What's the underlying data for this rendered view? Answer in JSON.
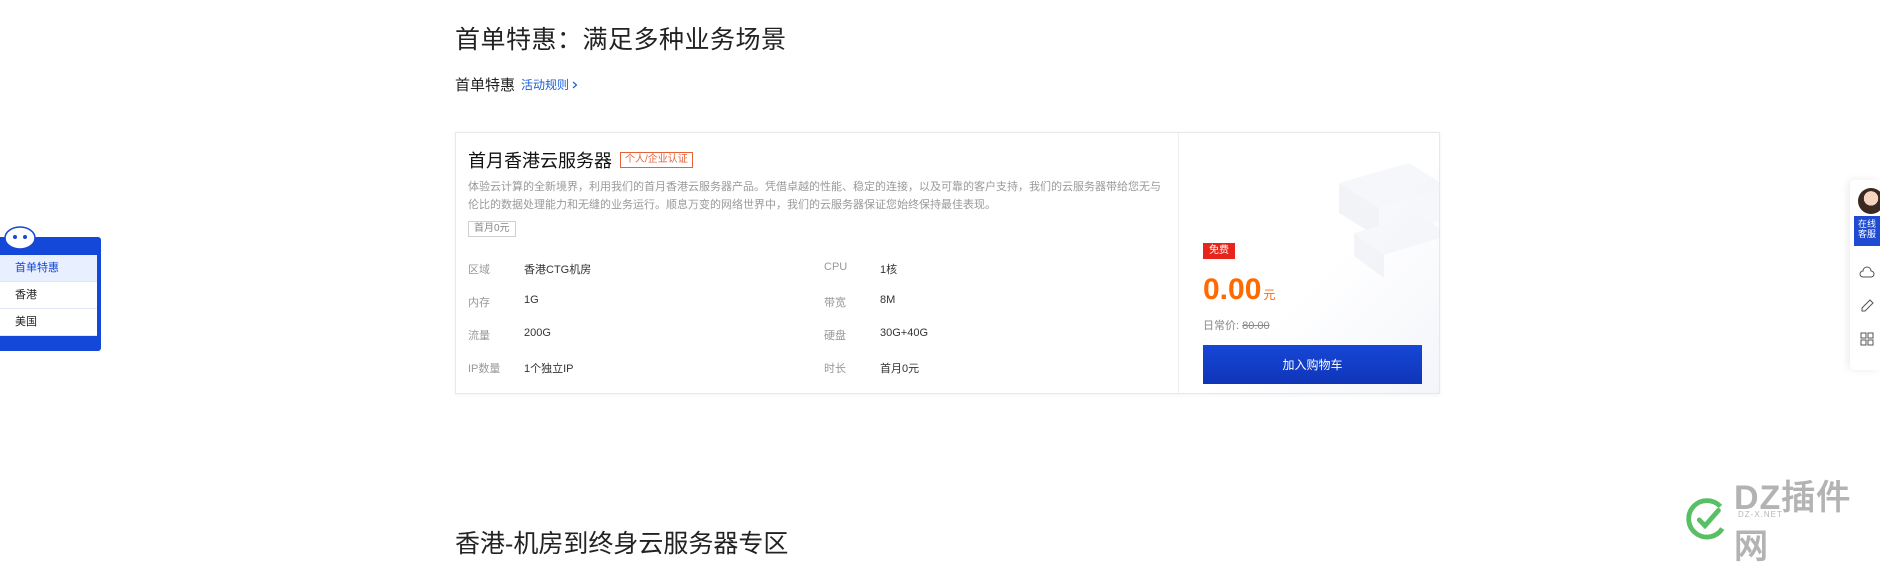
{
  "section": {
    "title": "首单特惠：满足多种业务场景",
    "subtitle": "首单特惠",
    "rules_link": "活动规则"
  },
  "product": {
    "name": "首月香港云服务器",
    "tag": "个人/企业认证",
    "description": "体验云计算的全新境界，利用我们的首月香港云服务器产品。凭借卓越的性能、稳定的连接，以及可靠的客户支持，我们的云服务器带给您无与伦比的数据处理能力和无缝的业务运行。顺息万变的网络世界中，我们的云服务器保证您始终保持最佳表现。",
    "chip": "首月0元",
    "specs": [
      {
        "label": "区域",
        "value": "香港CTG机房"
      },
      {
        "label": "CPU",
        "value": "1核"
      },
      {
        "label": "内存",
        "value": "1G"
      },
      {
        "label": "带宽",
        "value": "8M"
      },
      {
        "label": "流量",
        "value": "200G"
      },
      {
        "label": "硬盘",
        "value": "30G+40G"
      },
      {
        "label": "IP数量",
        "value": "1个独立IP"
      },
      {
        "label": "时长",
        "value": "首月0元"
      }
    ],
    "badge": "免费",
    "price": "0.00",
    "currency": "元",
    "original_label": "日常价:",
    "original_price": "80.00",
    "cta": "加入购物车"
  },
  "side_nav": {
    "items": [
      "首单特惠",
      "香港",
      "美国"
    ],
    "active_index": 0
  },
  "right_bar": {
    "head_text": "在线客服"
  },
  "watermark": {
    "text": "DZ插件网",
    "sub": "DZ-X.NET"
  },
  "next_section": {
    "title": "香港-机房到终身云服务器专区"
  },
  "colors": {
    "accent_blue": "#1348d8",
    "price_orange": "#ff6a00",
    "badge_red": "#e8251b"
  }
}
